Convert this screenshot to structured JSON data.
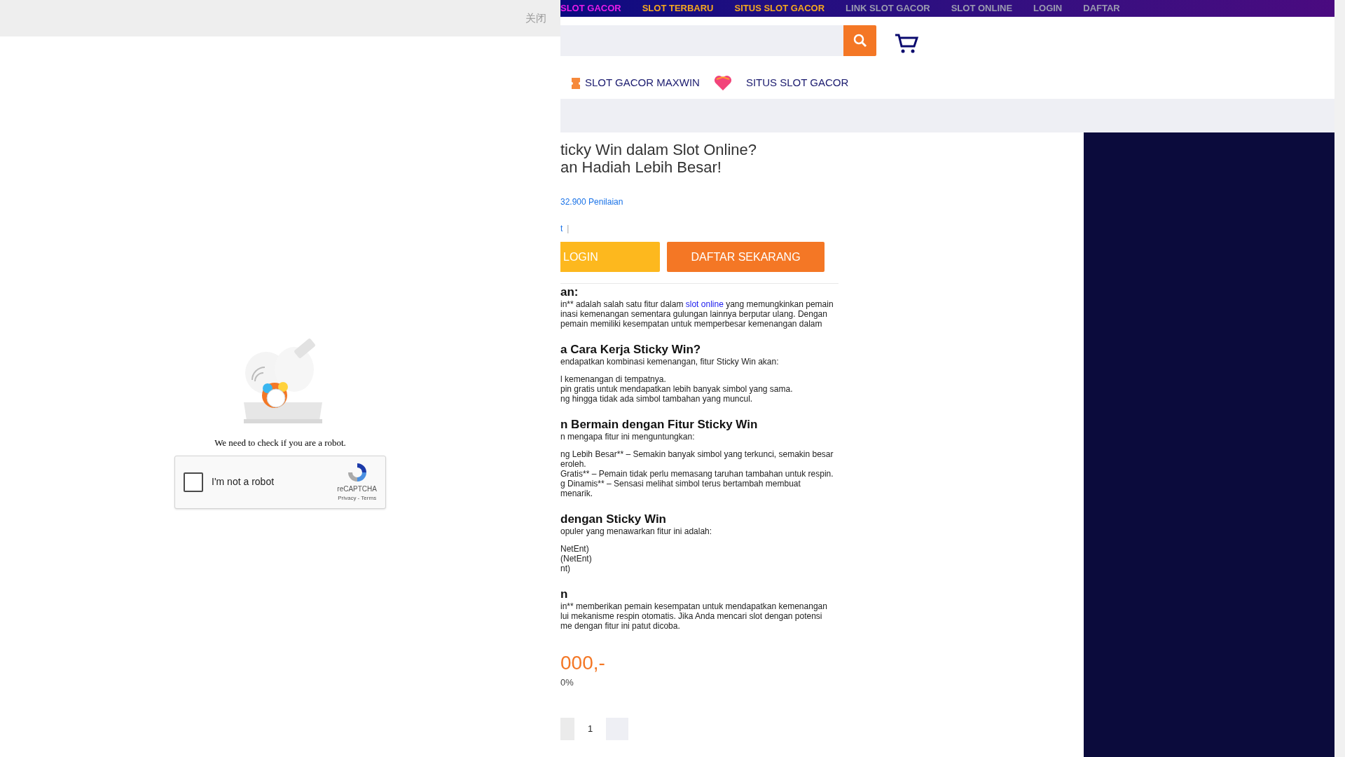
{
  "overlay": {
    "close_label": "关闭",
    "message": "We need to check if you are a robot.",
    "captcha": {
      "label": "I'm not a robot",
      "checked": false,
      "brand": "reCAPTCHA",
      "links": "Privacy - Terms"
    }
  },
  "nav": [
    {
      "label": "SLOT GACOR",
      "color": "#e81ce8"
    },
    {
      "label": "SLOT TERBARU",
      "color": "#f5a81e"
    },
    {
      "label": "SITUS SLOT GACOR",
      "color": "#f5a81e"
    },
    {
      "label": "LINK SLOT GACOR",
      "color": "#9c9cb0"
    },
    {
      "label": "SLOT ONLINE",
      "color": "#9c9cb0"
    },
    {
      "label": "LOGIN",
      "color": "#9c9cb0"
    },
    {
      "label": "DAFTAR",
      "color": "#9c9cb0"
    }
  ],
  "menu": [
    {
      "label": "SLOT GACOR MAXWIN",
      "kind": "ticket"
    },
    {
      "label": "SITUS SLOT GACOR",
      "kind": "heart"
    }
  ],
  "product": {
    "title_lines": [
      "ticky Win dalam Slot Online?",
      "an Hadiah Lebih Besar!"
    ],
    "rating": "32.900 Penilaian",
    "link": "t",
    "separator": "|",
    "login_button": "LOGIN",
    "register_button": "DAFTAR SEKARANG",
    "sections": [
      {
        "heading": "an:",
        "intro": [
          {
            "text": "in** adalah salah satu fitur dalam ",
            "link": "slot online",
            "after": " yang memungkinkan pemain"
          },
          {
            "text": "inasi kemenangan sementara gulungan lainnya berputar ulang. Dengan"
          },
          {
            "text": "pemain memiliki kesempatan untuk memperbesar kemenangan dalam"
          }
        ]
      },
      {
        "heading": "a Cara Kerja Sticky Win?",
        "intro": [
          {
            "text": "endapatkan kombinasi kemenangan, fitur Sticky Win akan:"
          }
        ],
        "items": [
          {
            "text": "l kemenangan di tempatnya."
          },
          {
            "text": "pin gratis untuk mendapatkan lebih banyak simbol yang sama."
          },
          {
            "text": "ng hingga tidak ada simbol tambahan yang muncul."
          }
        ]
      },
      {
        "heading": "n Bermain dengan Fitur Sticky Win",
        "intro": [
          {
            "text": "n mengapa fitur ini menguntungkan:"
          }
        ],
        "items": [
          {
            "text": "ng Lebih Besar** – Semakin banyak simbol yang terkunci, semakin besar"
          },
          {
            "text": "eroleh."
          },
          {
            "text": "Gratis** – Pemain tidak perlu memasang taruhan tambahan untuk respin."
          },
          {
            "text": "g Dinamis** – Sensasi melihat simbol terus bertambah membuat"
          },
          {
            "text": "menarik."
          }
        ]
      },
      {
        "heading": "dengan Sticky Win",
        "intro": [
          {
            "text": "opuler yang menawarkan fitur ini adalah:"
          }
        ],
        "items": [
          {
            "text": "NetEnt)"
          },
          {
            "text": "(NetEnt)"
          },
          {
            "text": "nt)"
          }
        ]
      },
      {
        "heading": "n",
        "intro": [
          {
            "text": "in** memberikan pemain kesempatan untuk mendapatkan kemenangan"
          },
          {
            "text": "lui mekanisme respin otomatis. Jika Anda mencari slot dengan potensi"
          },
          {
            "text": "me dengan fitur ini patut dicoba."
          }
        ]
      }
    ],
    "price": "000,-",
    "rtp": "0%",
    "quantity": "1"
  }
}
